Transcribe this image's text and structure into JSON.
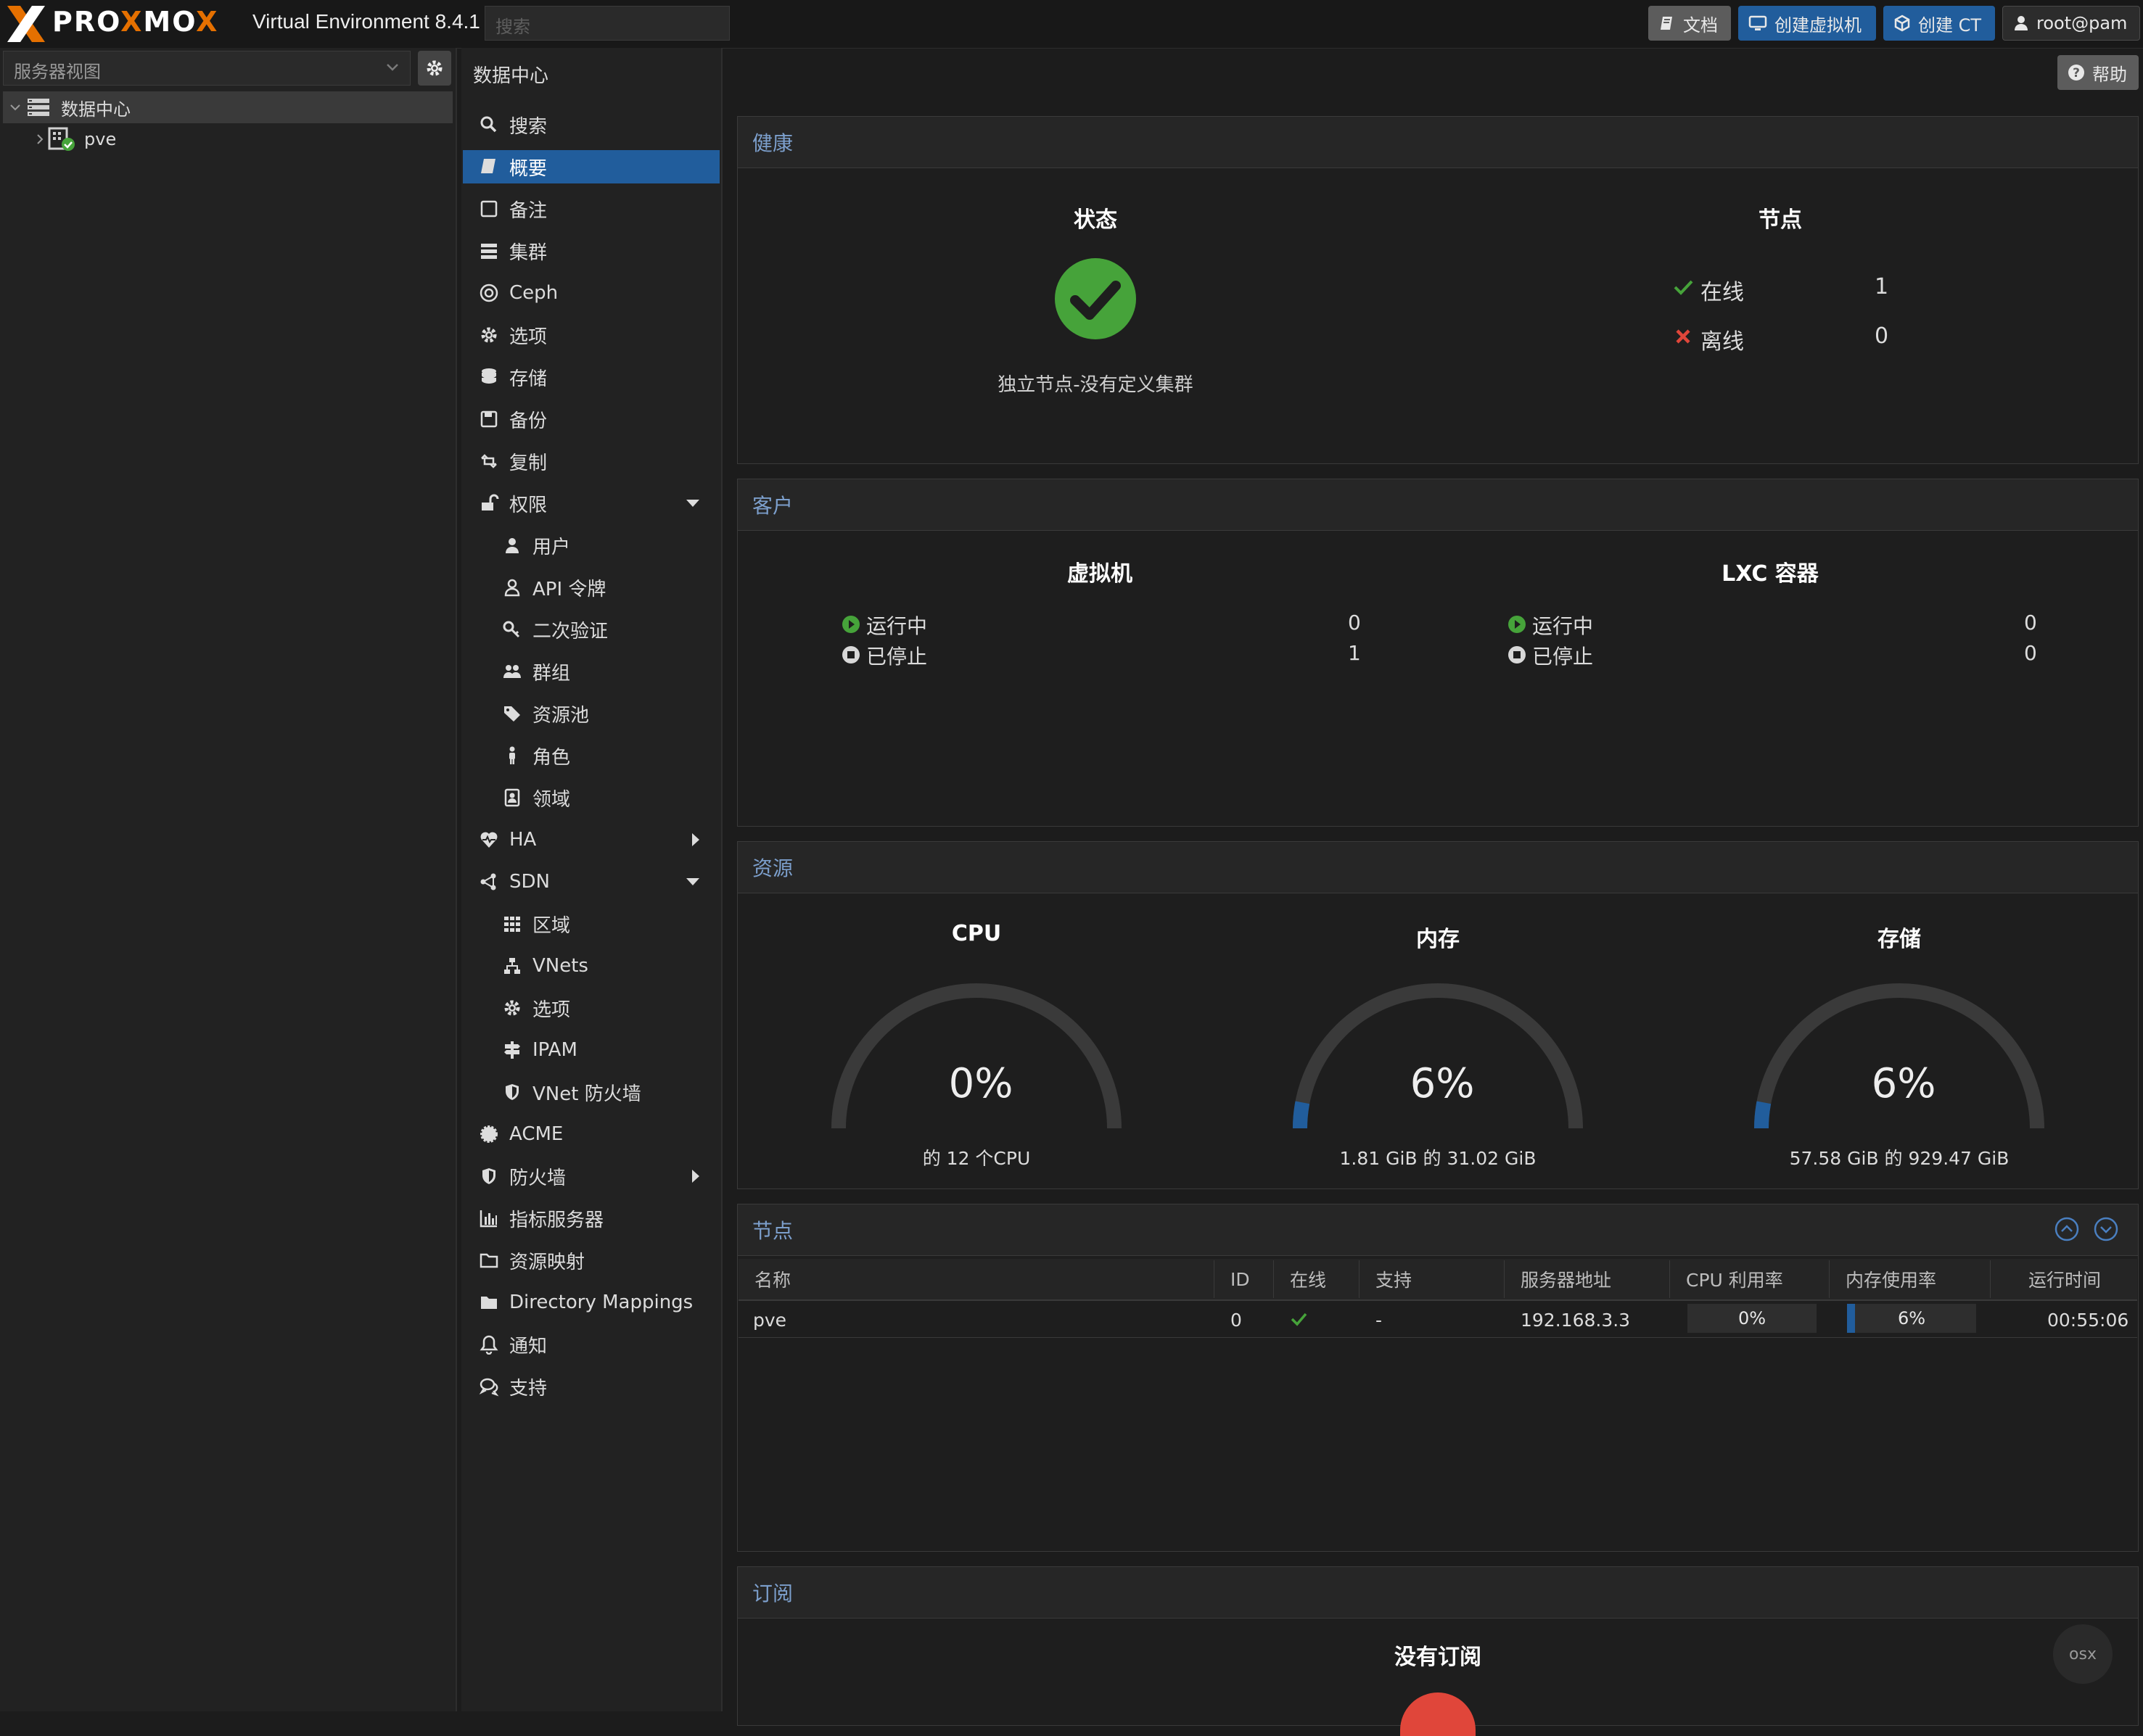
{
  "app": {
    "brand_left": "PRO",
    "brand_x1": "X",
    "brand_mid": "MO",
    "brand_x2": "X",
    "version": "Virtual Environment 8.4.1",
    "search_placeholder": "搜索"
  },
  "toolbar": {
    "docs": "文档",
    "create_vm": "创建虚拟机",
    "create_ct": "创建 CT",
    "user": "root@pam"
  },
  "left": {
    "view_label": "服务器视图",
    "tree": [
      {
        "label": "数据中心"
      },
      {
        "label": "pve"
      }
    ]
  },
  "nav": {
    "title": "数据中心",
    "help": "帮助",
    "items": [
      {
        "label": "搜索",
        "icon": "search-icon"
      },
      {
        "label": "概要",
        "icon": "book-icon"
      },
      {
        "label": "备注",
        "icon": "note-icon"
      },
      {
        "label": "集群",
        "icon": "server-stack-icon"
      },
      {
        "label": "Ceph",
        "icon": "ceph-icon"
      },
      {
        "label": "选项",
        "icon": "gear-icon"
      },
      {
        "label": "存储",
        "icon": "database-icon"
      },
      {
        "label": "备份",
        "icon": "floppy-icon"
      },
      {
        "label": "复制",
        "icon": "retweet-icon"
      },
      {
        "label": "权限",
        "icon": "unlock-icon"
      },
      {
        "label": "用户",
        "icon": "user-icon"
      },
      {
        "label": "API 令牌",
        "icon": "user-outline-icon"
      },
      {
        "label": "二次验证",
        "icon": "key-icon"
      },
      {
        "label": "群组",
        "icon": "users-icon"
      },
      {
        "label": "资源池",
        "icon": "tags-icon"
      },
      {
        "label": "角色",
        "icon": "male-icon"
      },
      {
        "label": "领域",
        "icon": "address-book-icon"
      },
      {
        "label": "HA",
        "icon": "heartbeat-icon"
      },
      {
        "label": "SDN",
        "icon": "sdn-icon"
      },
      {
        "label": "区域",
        "icon": "grid-icon"
      },
      {
        "label": "VNets",
        "icon": "sitemap-icon"
      },
      {
        "label": "选项",
        "icon": "gear-icon"
      },
      {
        "label": "IPAM",
        "icon": "signpost-icon"
      },
      {
        "label": "VNet 防火墙",
        "icon": "shield-icon"
      },
      {
        "label": "ACME",
        "icon": "certificate-icon"
      },
      {
        "label": "防火墙",
        "icon": "shield-icon"
      },
      {
        "label": "指标服务器",
        "icon": "bar-chart-icon"
      },
      {
        "label": "资源映射",
        "icon": "folder-outline-icon"
      },
      {
        "label": "Directory Mappings",
        "icon": "folder-icon"
      },
      {
        "label": "通知",
        "icon": "bell-icon"
      },
      {
        "label": "支持",
        "icon": "comments-icon"
      }
    ]
  },
  "health": {
    "header": "健康",
    "status_title": "状态",
    "status_text": "独立节点-没有定义集群",
    "nodes_title": "节点",
    "online_label": "在线",
    "online_value": "1",
    "offline_label": "离线",
    "offline_value": "0"
  },
  "guests": {
    "header": "客户",
    "vm_title": "虚拟机",
    "lxc_title": "LXC 容器",
    "running_label": "运行中",
    "stopped_label": "已停止",
    "vm_running": "0",
    "vm_stopped": "1",
    "lxc_running": "0",
    "lxc_stopped": "0"
  },
  "resources": {
    "header": "资源",
    "gauges": [
      {
        "title": "CPU",
        "value_text": "0%",
        "percent": 0,
        "sub": "的 12 个CPU"
      },
      {
        "title": "内存",
        "value_text": "6%",
        "percent": 6,
        "sub": "1.81 GiB 的 31.02 GiB"
      },
      {
        "title": "存储",
        "value_text": "6%",
        "percent": 6,
        "sub": "57.58 GiB 的 929.47 GiB"
      }
    ],
    "accent": "#215d9c"
  },
  "nodes": {
    "header": "节点",
    "columns": [
      "名称",
      "ID",
      "在线",
      "支持",
      "服务器地址",
      "CPU 利用率",
      "内存使用率",
      "运行时间"
    ],
    "rows": [
      {
        "name": "pve",
        "id": "0",
        "online": "check",
        "support": "-",
        "address": "192.168.3.3",
        "cpu": "0%",
        "cpu_frac": 0,
        "mem": "6%",
        "mem_frac": 0.06,
        "uptime": "00:55:06"
      }
    ]
  },
  "subscription": {
    "header": "订阅",
    "title": "没有订阅"
  },
  "watermark": "osx"
}
